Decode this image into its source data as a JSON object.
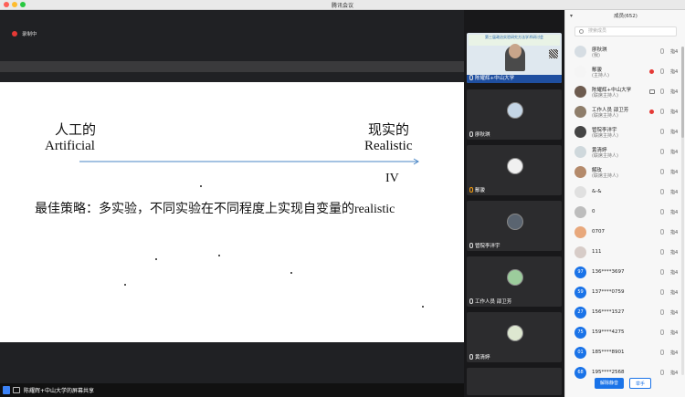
{
  "window": {
    "title": "腾讯会议"
  },
  "stage": {
    "recording_label": "录制中",
    "slide": {
      "artificial_cn": "人工的",
      "artificial_en": "Artificial",
      "realistic_cn": "现实的",
      "realistic_en": "Realistic",
      "roman": "IV",
      "strategy": "最佳策略：多实验，不同实验在不同程度上实现自变量的realistic"
    },
    "share_label": "陈耀辉+中山大学的屏幕共享"
  },
  "video_strip": {
    "main_banner": "第三届政治实验研究方法学术研讨会",
    "tiles": [
      {
        "name": "陈耀辉+中山大学",
        "video": true
      },
      {
        "name": "廖秋琪",
        "video": false
      },
      {
        "name": "鄢骏",
        "video": false
      },
      {
        "name": "管院李洋宇",
        "video": false
      },
      {
        "name": "工作人员 邵卫芳",
        "video": false
      },
      {
        "name": "黄清婷",
        "video": false
      }
    ]
  },
  "panel": {
    "title": "成员(652)",
    "search_placeholder": "搜索成员",
    "members": [
      {
        "name": "廖秋琪",
        "role": "(我)",
        "avatar": "",
        "status": ""
      },
      {
        "name": "鄢骏",
        "role": "(主持人)",
        "avatar": "",
        "status": "rec"
      },
      {
        "name": "陈耀辉+中山大学",
        "role": "(联席主持人)",
        "avatar": "",
        "status": "screen"
      },
      {
        "name": "工作人员 邵卫芳",
        "role": "(联席主持人)",
        "avatar": "",
        "status": "rec"
      },
      {
        "name": "管院李洋宇",
        "role": "(联席主持人)",
        "avatar": "",
        "status": ""
      },
      {
        "name": "黄清婷",
        "role": "(联席主持人)",
        "avatar": "",
        "status": ""
      },
      {
        "name": "解玫",
        "role": "(联席主持人)",
        "avatar": "",
        "status": ""
      },
      {
        "name": "&-&",
        "role": "",
        "avatar": "",
        "status": ""
      },
      {
        "name": "0",
        "role": "",
        "avatar": "",
        "status": ""
      },
      {
        "name": "0707",
        "role": "",
        "avatar": "",
        "status": ""
      },
      {
        "name": "111",
        "role": "",
        "avatar": "",
        "status": ""
      },
      {
        "name": "136****3697",
        "role": "",
        "avatar": "97",
        "status": ""
      },
      {
        "name": "137****0759",
        "role": "",
        "avatar": "59",
        "status": ""
      },
      {
        "name": "156****1527",
        "role": "",
        "avatar": "27",
        "status": ""
      },
      {
        "name": "159****4275",
        "role": "",
        "avatar": "75",
        "status": ""
      },
      {
        "name": "185****8901",
        "role": "",
        "avatar": "01",
        "status": ""
      },
      {
        "name": "195****2568",
        "role": "",
        "avatar": "68",
        "status": ""
      }
    ],
    "more_label": "指4",
    "mute_all_label": "解除静音",
    "raise_hand_label": "举手"
  },
  "colors": {
    "accent": "#1a73e8",
    "record": "#e53935"
  }
}
